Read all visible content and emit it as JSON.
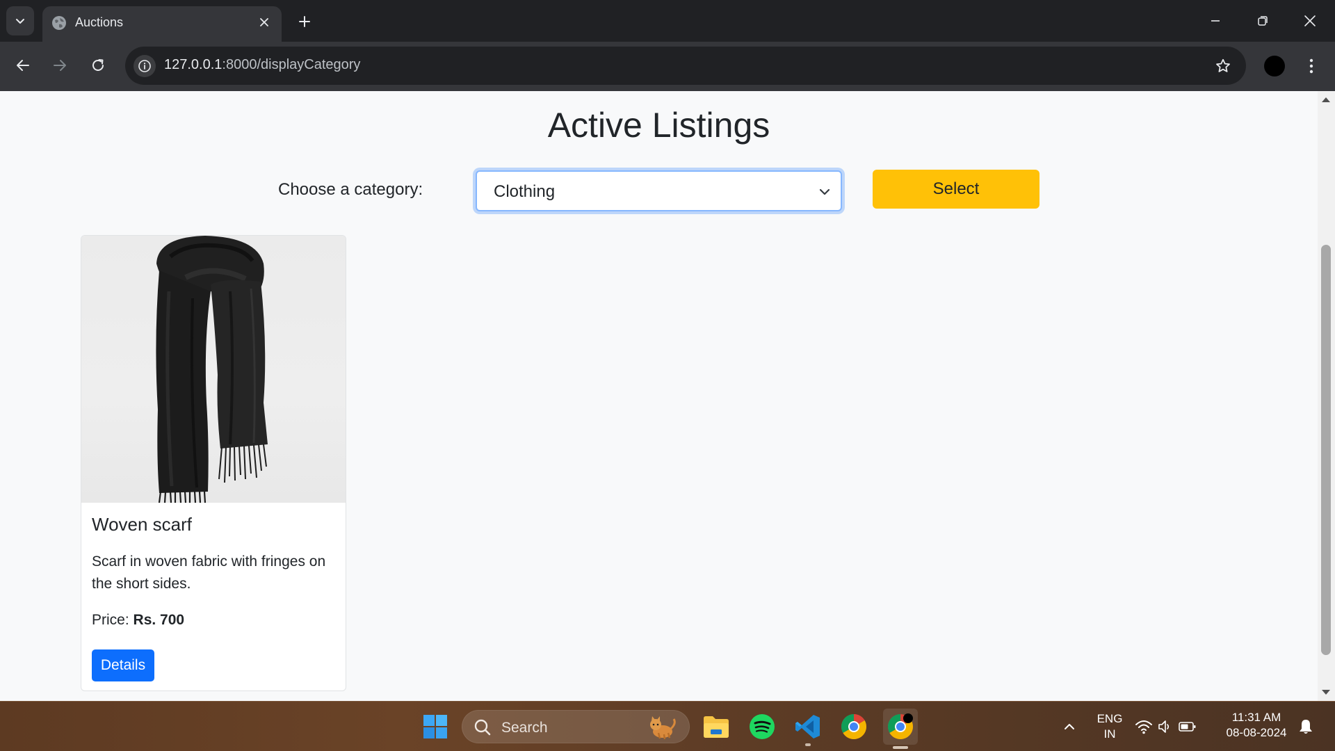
{
  "browser": {
    "tab_title": "Auctions",
    "url_host": "127.0.0.1",
    "url_path": ":8000/displayCategory"
  },
  "page": {
    "title": "Active Listings",
    "category_label": "Choose a category:",
    "selected_category": "Clothing",
    "select_button": "Select"
  },
  "listings": [
    {
      "title": "Woven scarf",
      "description": "Scarf in woven fabric with fringes on the short sides.",
      "price_label": "Price:",
      "price": "Rs. 700",
      "details_label": "Details"
    }
  ],
  "taskbar": {
    "search_label": "Search",
    "lang_top": "ENG",
    "lang_bottom": "IN",
    "time": "11:31 AM",
    "date": "08-08-2024"
  },
  "colors": {
    "accent_yellow": "#ffc107",
    "primary_blue": "#0d6efd",
    "chrome_dark": "#202124",
    "chrome_toolbar": "#35363a"
  },
  "icons": [
    "tab-search-icon",
    "globe-icon",
    "close-icon",
    "plus-icon",
    "minimize-icon",
    "restore-icon",
    "back-icon",
    "forward-icon",
    "reload-icon",
    "site-info-icon",
    "star-icon",
    "kebab-menu-icon",
    "chevron-down-icon",
    "windows-start-icon",
    "search-icon",
    "file-explorer-icon",
    "spotify-icon",
    "vscode-icon",
    "chrome-icon",
    "chevron-up-icon",
    "wifi-icon",
    "volume-icon",
    "battery-icon",
    "bell-icon"
  ]
}
